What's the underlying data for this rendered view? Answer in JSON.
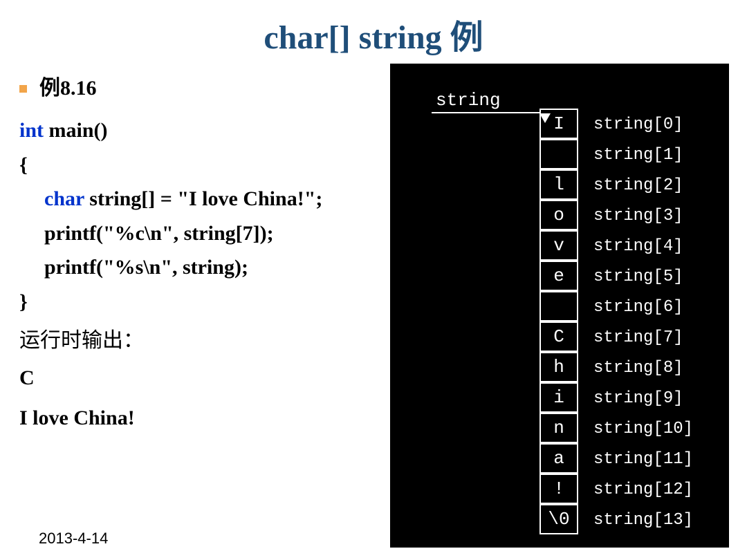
{
  "title": "char[] string 例",
  "bullet": "例8.16",
  "code": {
    "l1a": "int",
    "l1b": " main()",
    "l2": "{",
    "l3a": "char",
    "l3b": " string[] = \"I love China!\";",
    "l4": "printf(\"%c\\n\", string[7]);",
    "l5": "printf(\"%s\\n\", string);",
    "l6": "}"
  },
  "run_label": "运行时输出：",
  "out1": "C",
  "out2": "I love China!",
  "footer": "2013-4-14",
  "diagram": {
    "label": "string",
    "rows": [
      {
        "ch": "I",
        "idx": "string[0]"
      },
      {
        "ch": "",
        "idx": "string[1]"
      },
      {
        "ch": "l",
        "idx": "string[2]"
      },
      {
        "ch": "o",
        "idx": "string[3]"
      },
      {
        "ch": "v",
        "idx": "string[4]"
      },
      {
        "ch": "e",
        "idx": "string[5]"
      },
      {
        "ch": "",
        "idx": "string[6]"
      },
      {
        "ch": "C",
        "idx": "string[7]"
      },
      {
        "ch": "h",
        "idx": "string[8]"
      },
      {
        "ch": "i",
        "idx": "string[9]"
      },
      {
        "ch": "n",
        "idx": "string[10]"
      },
      {
        "ch": "a",
        "idx": "string[11]"
      },
      {
        "ch": "!",
        "idx": "string[12]"
      },
      {
        "ch": "\\0",
        "idx": "string[13]"
      }
    ]
  }
}
